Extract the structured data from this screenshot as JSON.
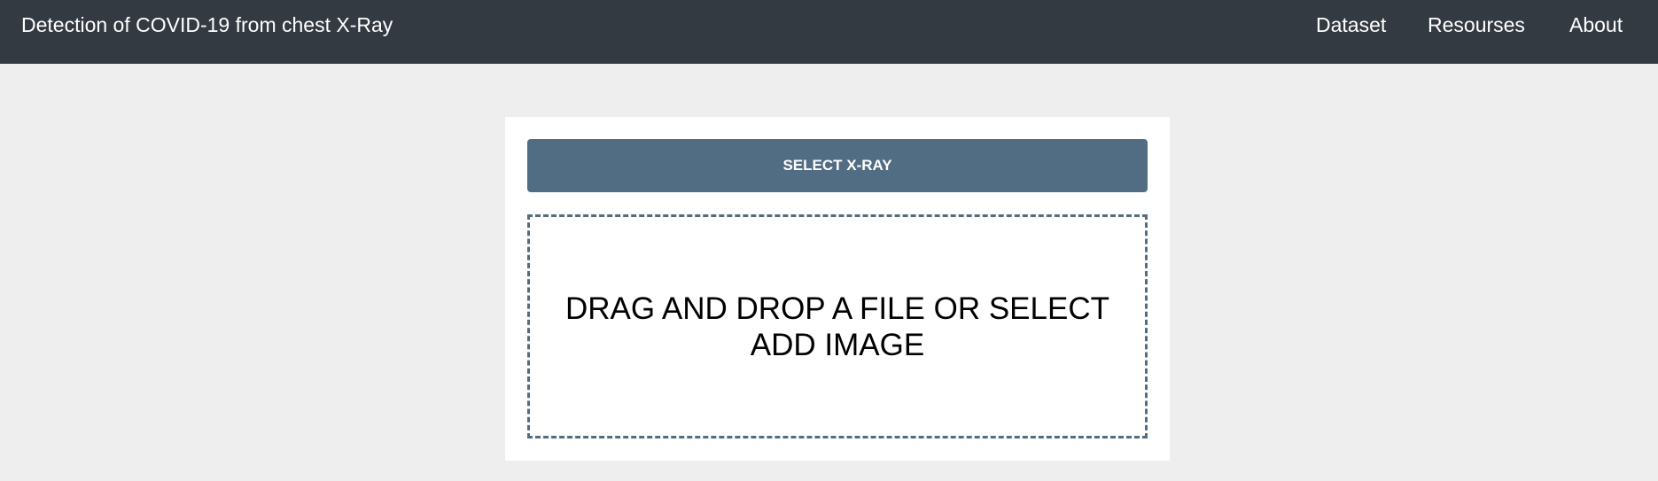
{
  "header": {
    "title": "Detection of COVID-19 from chest X-Ray",
    "nav": [
      "Dataset",
      "Resourses",
      "About"
    ]
  },
  "upload": {
    "select_label": "SELECT X-RAY",
    "dropzone_text": "DRAG AND DROP A FILE OR SELECT ADD IMAGE"
  },
  "colors": {
    "header_bg": "#343a42",
    "page_bg": "#eeeeee",
    "accent": "#516d83"
  }
}
